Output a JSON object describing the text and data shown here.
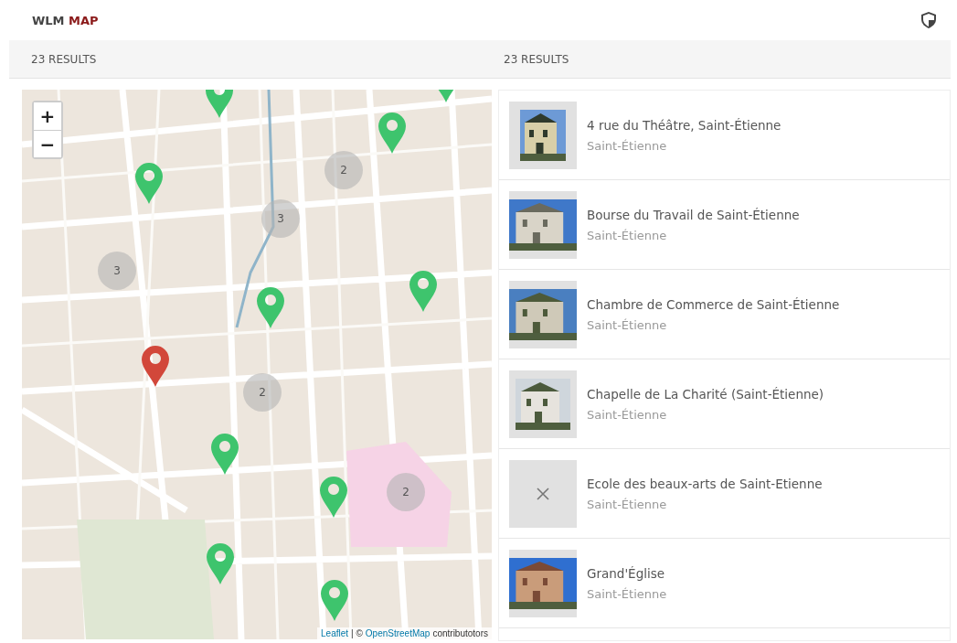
{
  "header": {
    "brand_first": "WLM",
    "brand_second": "MAP"
  },
  "results_bar": {
    "left_count": "23 RESULTS",
    "right_count": "23 RESULTS"
  },
  "map": {
    "zoom_in": "+",
    "zoom_out": "−",
    "attribution_link_1": "Leaflet",
    "attribution_sep": "| ©",
    "attribution_link_2": "OpenStreetMap",
    "attribution_tail": "contributotors",
    "markers": [
      {
        "color": "#3ec46d"
      },
      {
        "color": "#3ec46d"
      },
      {
        "color": "#3ec46d"
      },
      {
        "color": "#3ec46d"
      },
      {
        "color": "#3ec46d"
      },
      {
        "color": "#d2473a"
      },
      {
        "color": "#3ec46d"
      },
      {
        "color": "#3ec46d"
      },
      {
        "color": "#3ec46d"
      },
      {
        "color": "#3ec46d"
      },
      {
        "color": "#3ec46d"
      }
    ],
    "clusters": [
      {
        "count": "2"
      },
      {
        "count": "3"
      },
      {
        "count": "3"
      },
      {
        "count": "2"
      },
      {
        "count": "2"
      }
    ]
  },
  "list": [
    {
      "title": "4 rue du Théâtre, Saint-Étienne",
      "subtitle": "Saint-Étienne",
      "kind": "picture"
    },
    {
      "title": "Bourse du Travail de Saint-Étienne",
      "subtitle": "Saint-Étienne",
      "kind": "picture"
    },
    {
      "title": "Chambre de Commerce de Saint-Étienne",
      "subtitle": "Saint-Étienne",
      "kind": "picture"
    },
    {
      "title": "Chapelle de La Charité (Saint-Étienne)",
      "subtitle": "Saint-Étienne",
      "kind": "picture"
    },
    {
      "title": "Ecole des beaux-arts de Saint-Etienne",
      "subtitle": "Saint-Étienne",
      "kind": "missing"
    },
    {
      "title": "Grand'Église",
      "subtitle": "Saint-Étienne",
      "kind": "picture"
    }
  ]
}
